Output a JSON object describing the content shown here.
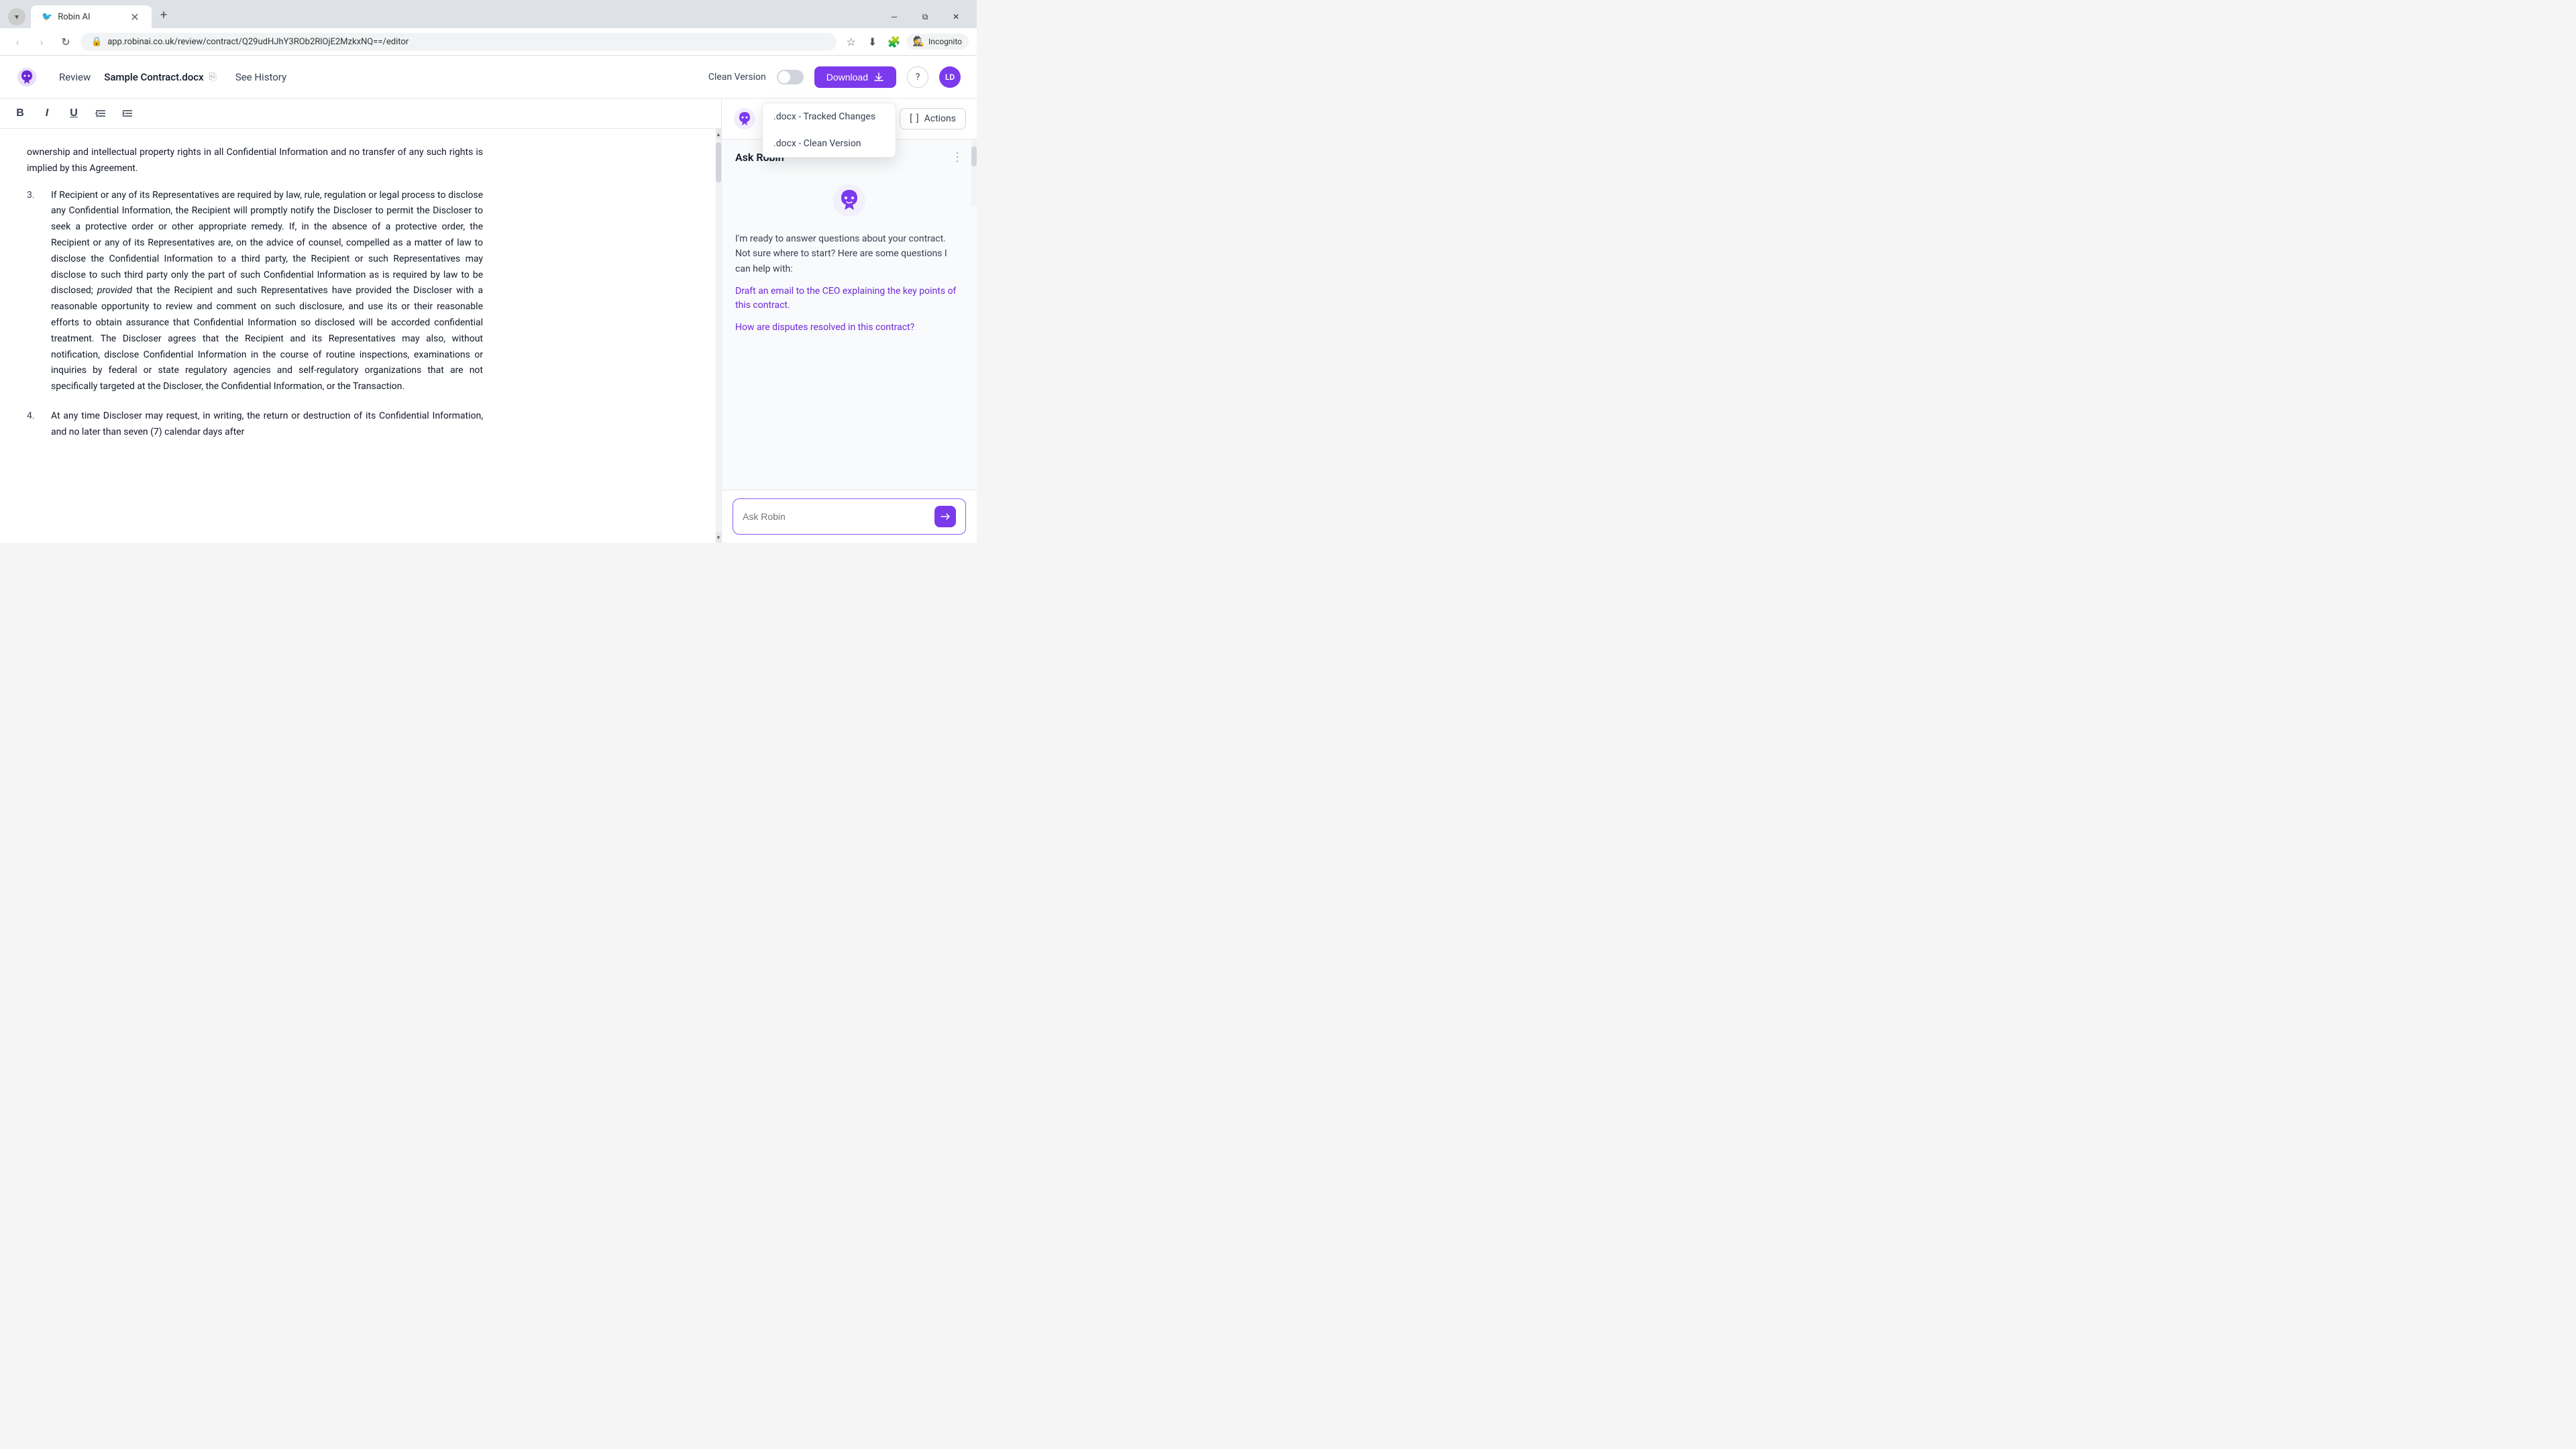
{
  "browser": {
    "tab_title": "Robin AI",
    "tab_icon": "🐦",
    "url": "app.robinai.co.uk/review/contract/Q29udHJhY3ROb2RlOjE2MzkxNQ==/editor",
    "incognito_label": "Incognito"
  },
  "header": {
    "logo_alt": "Robin AI Logo",
    "nav_review": "Review",
    "file_name": "Sample Contract.docx",
    "see_history": "See History",
    "clean_version_label": "Clean Version",
    "download_btn_label": "Download",
    "help_btn_label": "?",
    "user_initials": "LD"
  },
  "download_dropdown": {
    "option1": ".docx - Tracked Changes",
    "option2": ".docx - Clean Version"
  },
  "editor_toolbar": {
    "bold": "B",
    "italic": "I",
    "underline": "U",
    "indent_decrease": "⇤",
    "indent_increase": "⇥"
  },
  "document": {
    "intro_text": "ownership and intellectual property rights in all Confidential Information and no transfer of any such rights is implied by this Agreement.",
    "section3_num": "3.",
    "section3_text": "If Recipient or any of its Representatives are required by law, rule, regulation or legal process to disclose any Confidential Information, the Recipient will promptly notify the Discloser to permit the Discloser to seek a protective order or other appropriate remedy. If, in the absence of a protective order, the Recipient or any of its Representatives are, on the advice of counsel, compelled as a matter of law to disclose the Confidential Information to a third party, the Recipient or such Representatives may disclose to such third party only the part of such Confidential Information as is required by law to be disclosed;",
    "section3_provided": "provided",
    "section3_continued": "that the Recipient and such Representatives have provided the Discloser with a reasonable opportunity to review and comment on such disclosure, and use its or their reasonable efforts to obtain assurance that Confidential Information so disclosed will be accorded confidential treatment. The Discloser agrees that the Recipient and its Representatives may also, without notification, disclose Confidential Information in the course of routine inspections, examinations or inquiries by federal or state regulatory agencies and self-regulatory organizations that are not specifically targeted at the Discloser, the Confidential Information, or the Transaction.",
    "section4_num": "4.",
    "section4_text": "At any time Discloser may request, in writing, the return or destruction of its Confidential Information, and no later than seven (7) calendar days after"
  },
  "sidebar": {
    "actions_label": "[ ] Actions",
    "ask_robin_title": "Ask Robin",
    "robin_intro": "I'm ready to answer questions about your contract.\nNot sure where to start? Here are some questions I can help with:",
    "suggested_q1": "Draft an email to the CEO explaining the key points of this contract.",
    "suggested_q2": "How are disputes resolved in this contract?",
    "ask_robin_placeholder": "Ask Robin"
  }
}
